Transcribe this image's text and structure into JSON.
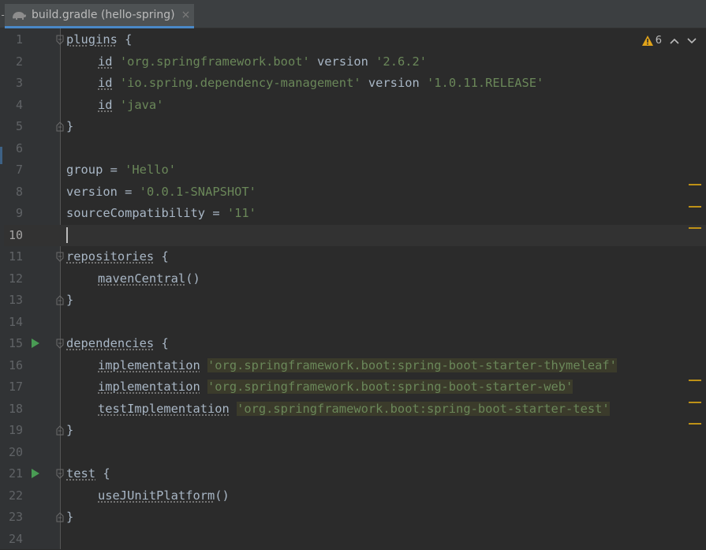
{
  "tab": {
    "title": "build.gradle (hello-spring)",
    "close_icon": "×",
    "gradle_icon": "gradle-elephant-icon"
  },
  "inspection": {
    "warning_count": "6",
    "warning_icon": "warning-triangle-icon",
    "colors": {
      "warning": "#e0a31a"
    }
  },
  "editor": {
    "current_line": 10,
    "lines": [
      {
        "n": "1"
      },
      {
        "n": "2"
      },
      {
        "n": "3"
      },
      {
        "n": "4"
      },
      {
        "n": "5"
      },
      {
        "n": "6"
      },
      {
        "n": "7"
      },
      {
        "n": "8"
      },
      {
        "n": "9"
      },
      {
        "n": "10"
      },
      {
        "n": "11"
      },
      {
        "n": "12"
      },
      {
        "n": "13"
      },
      {
        "n": "14"
      },
      {
        "n": "15"
      },
      {
        "n": "16"
      },
      {
        "n": "17"
      },
      {
        "n": "18"
      },
      {
        "n": "19"
      },
      {
        "n": "20"
      },
      {
        "n": "21"
      },
      {
        "n": "22"
      },
      {
        "n": "23"
      },
      {
        "n": "24"
      }
    ],
    "code": {
      "l1": {
        "a": "plugins",
        "b": " {"
      },
      "l2": {
        "a": "id",
        "b": "'org.springframework.boot'",
        "c": " version ",
        "d": "'2.6.2'"
      },
      "l3": {
        "a": "id",
        "b": "'io.spring.dependency-management'",
        "c": " version ",
        "d": "'1.0.11.RELEASE'"
      },
      "l4": {
        "a": "id",
        "b": "'java'"
      },
      "l5": {
        "a": "}"
      },
      "l7": {
        "a": "group = ",
        "b": "'Hello'"
      },
      "l8": {
        "a": "version = ",
        "b": "'0.0.1-SNAPSHOT'"
      },
      "l9": {
        "a": "sourceCompatibility = ",
        "b": "'11'"
      },
      "l11": {
        "a": "repositories",
        "b": " {"
      },
      "l12": {
        "a": "mavenCentral",
        "b": "()"
      },
      "l13": {
        "a": "}"
      },
      "l15": {
        "a": "dependencies",
        "b": " {"
      },
      "l16": {
        "a": "implementation",
        "b": "'org.springframework.boot:spring-boot-starter-thymeleaf'"
      },
      "l17": {
        "a": "implementation",
        "b": "'org.springframework.boot:spring-boot-starter-web'"
      },
      "l18": {
        "a": "testImplementation",
        "b": "'org.springframework.boot:spring-boot-starter-test'"
      },
      "l19": {
        "a": "}"
      },
      "l21": {
        "a": "test",
        "b": " {"
      },
      "l22": {
        "a": "useJUnitPlatform",
        "b": "()"
      },
      "l23": {
        "a": "}"
      }
    }
  },
  "colors": {
    "background": "#2b2b2b",
    "gutter": "#313335",
    "string": "#6a8759",
    "text": "#a9b7c6",
    "run": "#499c54",
    "marker": "#be9117"
  }
}
